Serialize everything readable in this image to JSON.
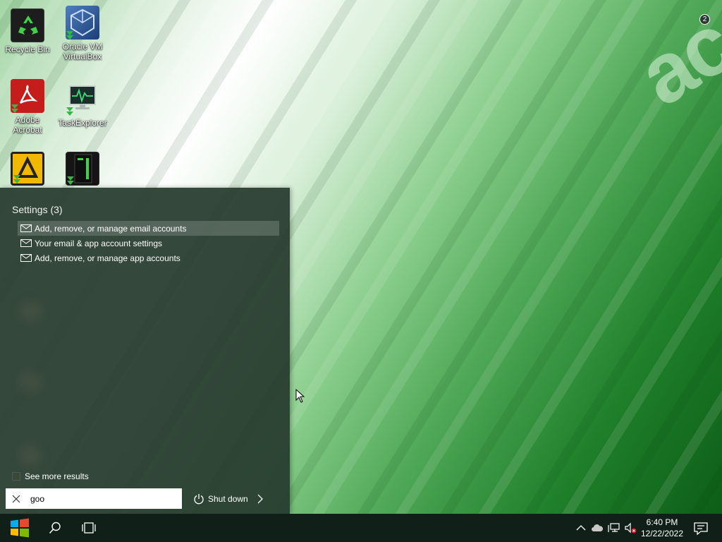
{
  "wallpaper": {
    "brand_text": "ace"
  },
  "desktop": {
    "icons": [
      {
        "label": "Recycle Bin",
        "icon": "recycle-bin-icon"
      },
      {
        "label": "Oracle VM VirtualBox",
        "icon": "virtualbox-icon"
      },
      {
        "label": "Adobe Acrobat",
        "icon": "acrobat-icon"
      },
      {
        "label": "TaskExplorer",
        "icon": "task-explorer-icon"
      },
      {
        "label": "",
        "icon": "aimp-icon"
      },
      {
        "label": "",
        "icon": "computer-case-icon"
      }
    ]
  },
  "search": {
    "section_title": "Settings (3)",
    "results": [
      {
        "label": "Add, remove, or manage email accounts",
        "icon": "mail-icon",
        "selected": true
      },
      {
        "label": "Your email & app account settings",
        "icon": "mail-icon"
      },
      {
        "label": "Add, remove, or manage app accounts",
        "icon": "mail-icon"
      }
    ],
    "see_more": "See more results",
    "query": "goo",
    "shutdown_label": "Shut down"
  },
  "taskbar": {
    "clock_time": "6:40 PM",
    "clock_date": "12/22/2022",
    "notification_count": "2"
  },
  "colors": {
    "panel": "#263a2d",
    "taskbar": "#101f18",
    "accent": "#1f7f2a"
  }
}
